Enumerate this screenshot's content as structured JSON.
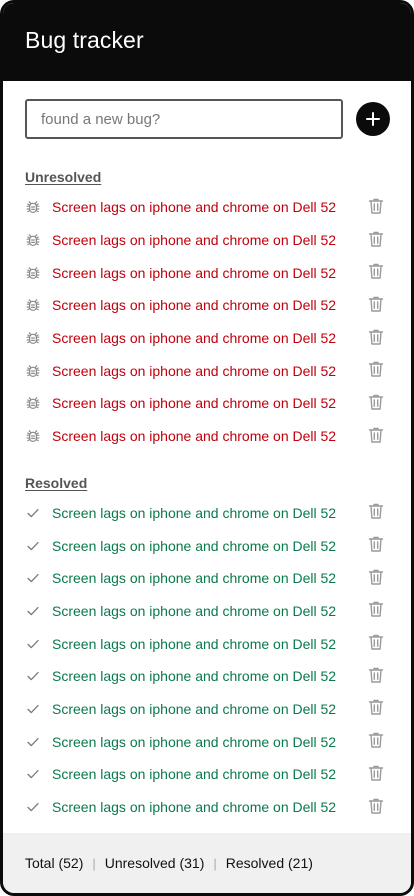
{
  "header": {
    "title": "Bug tracker"
  },
  "new_bug": {
    "placeholder": "found a new bug?",
    "value": ""
  },
  "unresolved": {
    "heading": "Unresolved",
    "items": [
      {
        "text": "Screen lags on iphone and chrome on Dell 52",
        "icon": "bug-icon"
      },
      {
        "text": "Screen lags on iphone and chrome on Dell 52",
        "icon": "bug-icon"
      },
      {
        "text": "Screen lags on iphone and chrome on Dell 52",
        "icon": "bug-icon"
      },
      {
        "text": "Screen lags on iphone and chrome on Dell 52",
        "icon": "bug-icon"
      },
      {
        "text": "Screen lags on iphone and chrome on Dell 52",
        "icon": "bug-icon"
      },
      {
        "text": "Screen lags on iphone and chrome on Dell 52",
        "icon": "bug-icon"
      },
      {
        "text": "Screen lags on iphone and chrome on Dell 52",
        "icon": "bug-icon"
      },
      {
        "text": "Screen lags on iphone and chrome on Dell 52",
        "icon": "bug-icon"
      }
    ]
  },
  "resolved": {
    "heading": "Resolved",
    "items": [
      {
        "text": "Screen lags on iphone and chrome on Dell 52",
        "icon": "check-icon"
      },
      {
        "text": "Screen lags on iphone and chrome on Dell 52",
        "icon": "check-icon"
      },
      {
        "text": "Screen lags on iphone and chrome on Dell 52",
        "icon": "check-icon"
      },
      {
        "text": "Screen lags on iphone and chrome on Dell 52",
        "icon": "check-icon"
      },
      {
        "text": "Screen lags on iphone and chrome on Dell 52",
        "icon": "check-icon"
      },
      {
        "text": "Screen lags on iphone and chrome on Dell 52",
        "icon": "check-icon"
      },
      {
        "text": "Screen lags on iphone and chrome on Dell 52",
        "icon": "check-icon"
      },
      {
        "text": "Screen lags on iphone and chrome on Dell 52",
        "icon": "check-icon"
      },
      {
        "text": "Screen lags on iphone and chrome on Dell 52",
        "icon": "check-icon"
      },
      {
        "text": "Screen lags on iphone and chrome on Dell 52",
        "icon": "check-icon"
      }
    ]
  },
  "footer": {
    "total": "Total (52)",
    "unresolved": "Unresolved (31)",
    "resolved": "Resolved (21)"
  },
  "colors": {
    "header_bg": "#0b0b0b",
    "unresolved_text": "#c0000c",
    "resolved_text": "#0a7a4c",
    "icon_gray": "#8a8a8a",
    "footer_bg": "#f0f0f0"
  }
}
